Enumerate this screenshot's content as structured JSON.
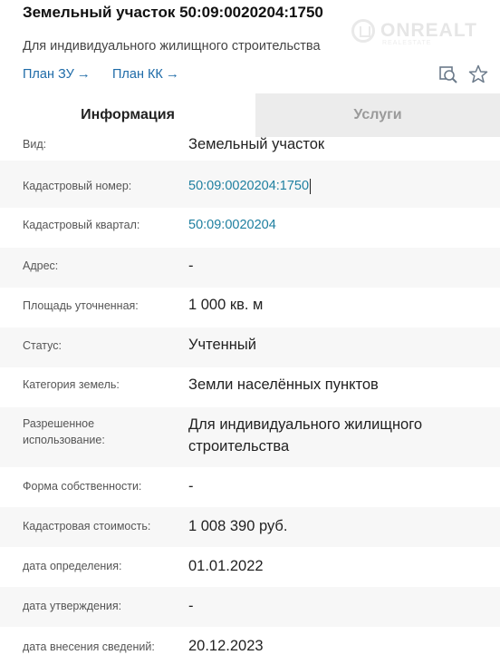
{
  "header": {
    "title": "Земельный участок 50:09:0020204:1750",
    "subtitle": "Для индивидуального жилищного строительства",
    "links": [
      {
        "label": "План ЗУ",
        "arrow": "→"
      },
      {
        "label": "План КК",
        "arrow": "→"
      }
    ],
    "watermark": {
      "text": "ONREALT",
      "subtext": "REALESTATE"
    },
    "icons": {
      "plan_search": "search-plan-icon",
      "favorite": "star-icon"
    }
  },
  "tabs": [
    {
      "label": "Информация",
      "active": true
    },
    {
      "label": "Услуги",
      "active": false
    }
  ],
  "properties": [
    {
      "label": "Вид:",
      "value": "Земельный участок"
    },
    {
      "label": "Кадастровый номер:",
      "value": "50:09:0020204:1750",
      "link": true
    },
    {
      "label": "Кадастровый квартал:",
      "value": "50:09:0020204",
      "link": true
    },
    {
      "label": "Адрес:",
      "value": "-"
    },
    {
      "label": "Площадь уточненная:",
      "value": "1 000 кв. м"
    },
    {
      "label": "Статус:",
      "value": "Учтенный"
    },
    {
      "label": "Категория земель:",
      "value": "Земли населённых пунктов"
    },
    {
      "label": "Разрешенное использование:",
      "value": "Для индивидуального жилищного строительства"
    },
    {
      "label": "Форма собственности:",
      "value": "-"
    },
    {
      "label": "Кадастровая стоимость:",
      "value": "1 008 390 руб."
    },
    {
      "label": "дата определения:",
      "value": "01.01.2022"
    },
    {
      "label": "дата утверждения:",
      "value": "-"
    },
    {
      "label": "дата внесения сведений:",
      "value": "20.12.2023"
    }
  ],
  "colors": {
    "link": "#1e6ba8",
    "value_link": "#1e7fa0",
    "tab_inactive_bg": "#ececec",
    "alt_row": "#f7f7f7"
  }
}
